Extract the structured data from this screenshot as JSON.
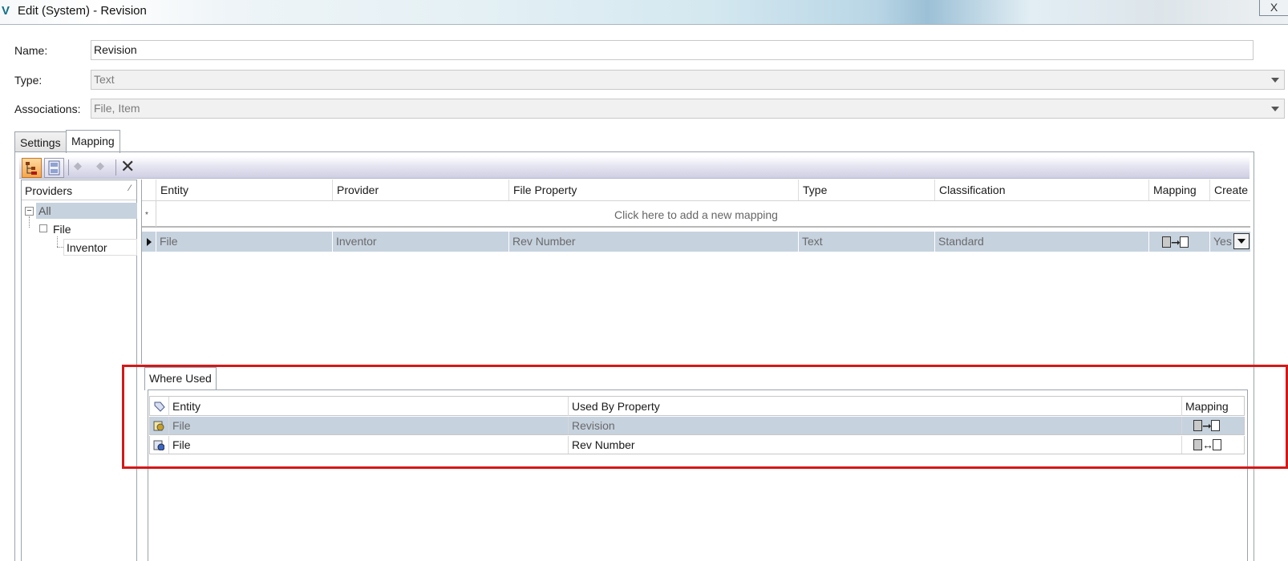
{
  "window": {
    "title": "Edit (System) - Revision",
    "app_icon": "V",
    "close_symbol": "X"
  },
  "form": {
    "name_label": "Name:",
    "name_value": "Revision",
    "type_label": "Type:",
    "type_value": "Text",
    "associations_label": "Associations:",
    "associations_value": "File, Item"
  },
  "tabs": [
    {
      "label": "Settings",
      "active": false
    },
    {
      "label": "Mapping",
      "active": true
    }
  ],
  "toolbar": {
    "delete_symbol": "✕",
    "icons": [
      "providers-view-icon",
      "save-icon",
      "move-down-icon",
      "move-up-icon",
      "delete-icon"
    ]
  },
  "providers": {
    "header": "Providers",
    "sort_symbol": "⁄",
    "tree": [
      {
        "label": "All",
        "level": 0,
        "expanded": true,
        "selected": true
      },
      {
        "label": "File",
        "level": 1,
        "expanded": true,
        "selected": false
      },
      {
        "label": "Inventor",
        "level": 2,
        "selected": false
      }
    ]
  },
  "mapping_grid": {
    "columns": [
      "Entity",
      "Provider",
      "File Property",
      "Type",
      "Classification",
      "Mapping",
      "Create"
    ],
    "new_row_prompt": "Click here to add a new mapping",
    "new_row_marker": "*",
    "rows": [
      {
        "entity": "File",
        "provider": "Inventor",
        "file_property": "Rev Number",
        "type": "Text",
        "classification": "Standard",
        "mapping": "read-only",
        "create": "Yes"
      }
    ]
  },
  "where_used": {
    "tab_label": "Where Used",
    "columns": [
      "Entity",
      "Used By Property",
      "Mapping"
    ],
    "rows": [
      {
        "entity": "File",
        "used_by_property": "Revision",
        "mapping": "read-only",
        "selected": true,
        "entity_icon": "file-property-gear-icon"
      },
      {
        "entity": "File",
        "used_by_property": "Rev Number",
        "mapping": "bidirectional",
        "selected": false,
        "entity_icon": "file-property-link-icon"
      }
    ]
  },
  "colors": {
    "selection": "#c6d2de",
    "highlight_border": "#d41818",
    "toolbar_active": "#f5a54a"
  }
}
